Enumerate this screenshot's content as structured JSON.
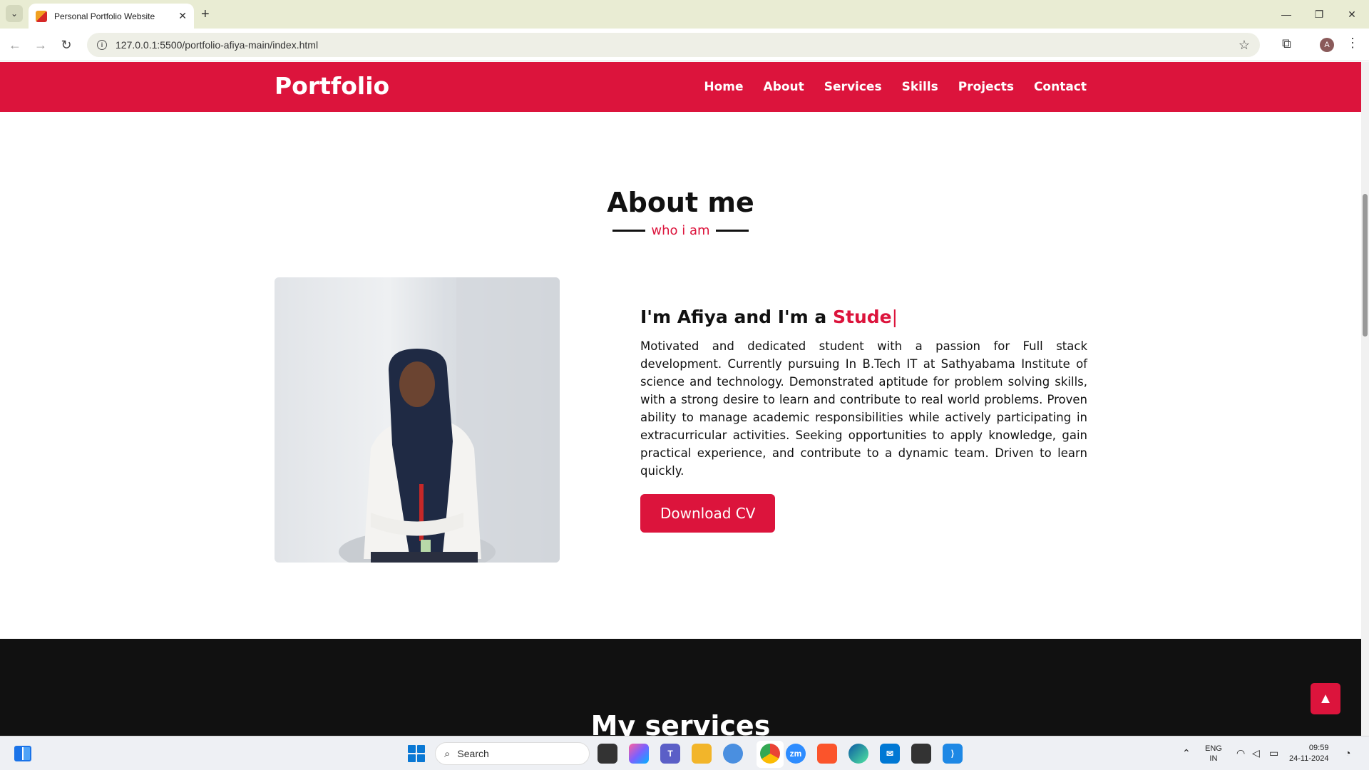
{
  "browser": {
    "tab_title": "Personal Portfolio Website",
    "url": "127.0.0.1:5500/portfolio-afiya-main/index.html",
    "profile_initial": "A"
  },
  "site": {
    "logo": "Portfolio",
    "nav": [
      "Home",
      "About",
      "Services",
      "Skills",
      "Projects",
      "Contact"
    ],
    "accent_color": "#dc143c"
  },
  "about": {
    "title": "About me",
    "subtitle": "who i am",
    "greeting_prefix": "I'm Afiya and I'm a ",
    "typed_text": "Stude",
    "cursor": "|",
    "bio": "Motivated and dedicated student with a passion for Full stack development. Currently pursuing In B.Tech IT at Sathyabama Institute of science and technology. Demonstrated aptitude for problem solving skills, with a strong desire to learn and contribute to real world problems. Proven ability to manage academic responsibilities while actively participating in extracurricular activities. Seeking opportunities to apply knowledge, gain practical experience, and contribute to a dynamic team. Driven to learn quickly.",
    "cv_button": "Download CV"
  },
  "services": {
    "title": "My services"
  },
  "taskbar": {
    "search_placeholder": "Search",
    "lang_line1": "ENG",
    "lang_line2": "IN",
    "time": "09:59",
    "date": "24-11-2024"
  },
  "icons": {
    "scroll_top": "chevron-up-icon",
    "bookmark": "star-icon",
    "extensions": "puzzle-icon"
  }
}
